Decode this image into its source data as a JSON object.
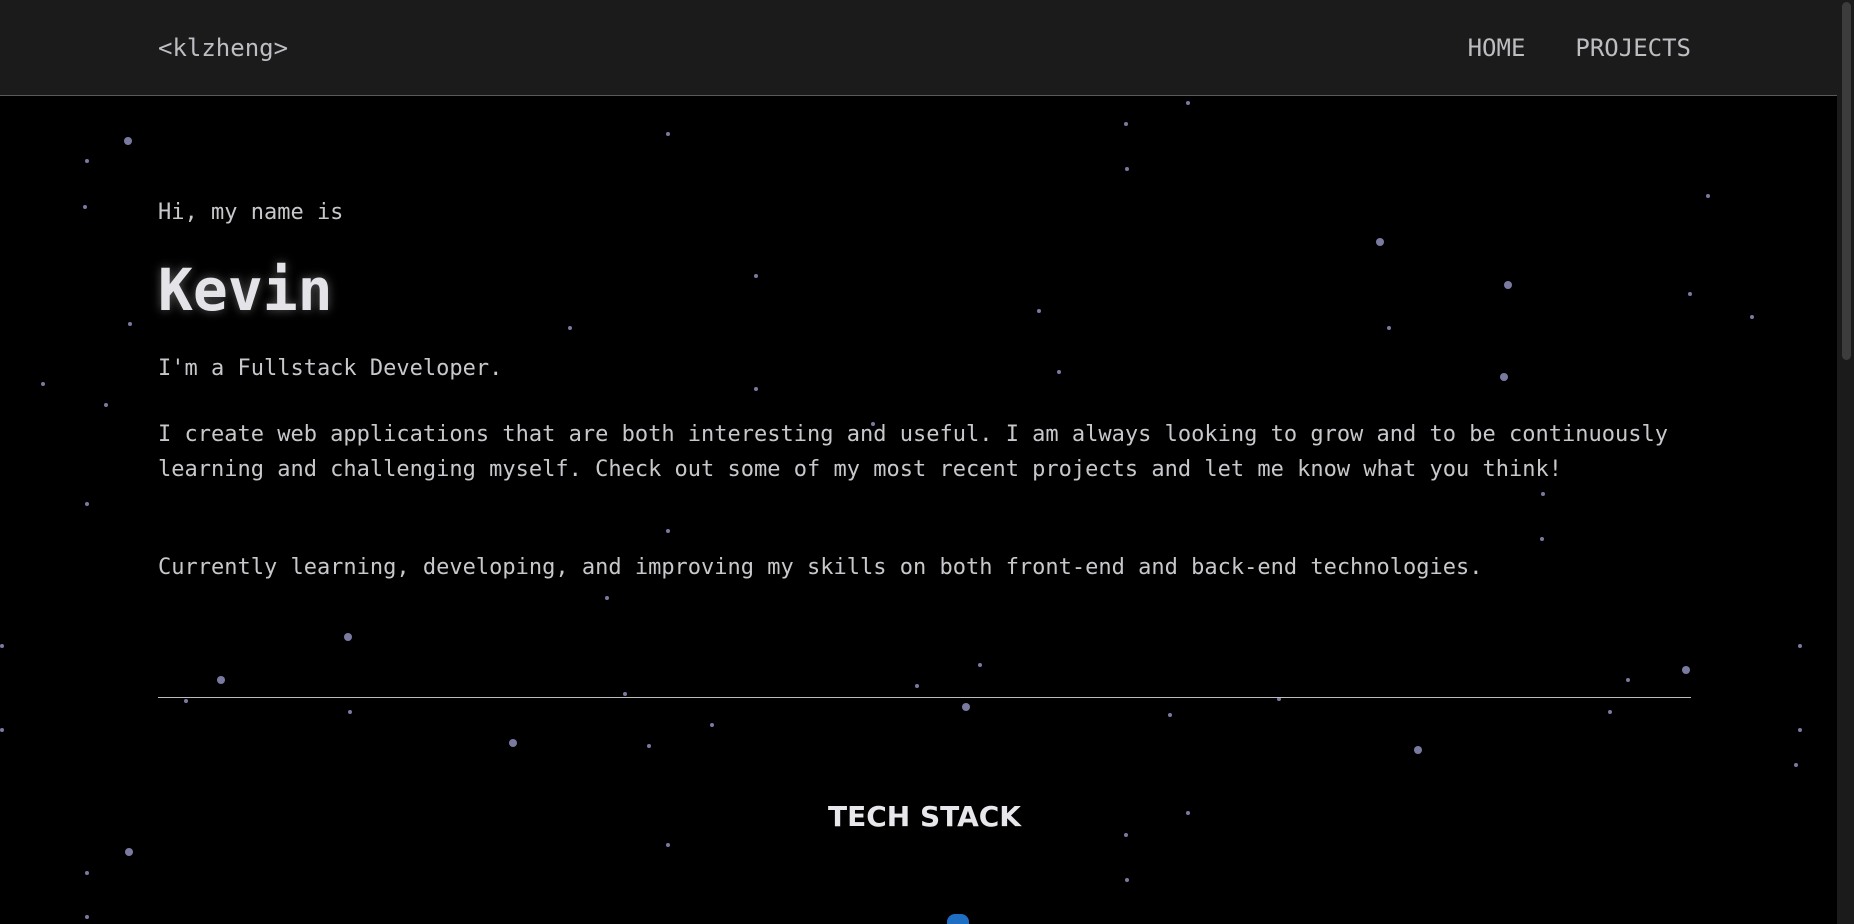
{
  "nav": {
    "logo": "<klzheng>",
    "links": [
      "HOME",
      "PROJECTS"
    ]
  },
  "hero": {
    "intro": "Hi, my name is",
    "name": "Kevin",
    "role": "I'm a Fullstack Developer.",
    "bio": "I create web applications that are both interesting and useful. I am always looking to grow and to be continuously learning and challenging myself. Check out some of my most recent projects and let me know what you think!",
    "learning": "Currently learning, developing, and improving my skills on both front-end and back-end technologies."
  },
  "tech_stack": {
    "title": "TECH STACK"
  },
  "colors": {
    "background": "#000000",
    "navbar": "#1b1b1b",
    "text": "#c8c8cc",
    "stars": "#8c8cb4",
    "icon_accent": "#1e6fc4"
  }
}
